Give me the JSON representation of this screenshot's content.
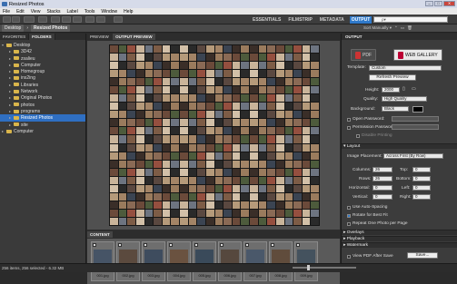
{
  "window": {
    "title": "Resized Photos"
  },
  "menu": [
    "File",
    "Edit",
    "View",
    "Stacks",
    "Label",
    "Tools",
    "Window",
    "Help"
  ],
  "workspaces": [
    {
      "label": "ESSENTIALS",
      "active": false
    },
    {
      "label": "FILMSTRIP",
      "active": false
    },
    {
      "label": "METADATA",
      "active": false
    },
    {
      "label": "OUTPUT",
      "active": true
    }
  ],
  "search": {
    "placeholder": "ρ▾"
  },
  "breadcrumb": {
    "root": "Desktop",
    "current": "Resized Photos"
  },
  "sort": {
    "label": "Sort Manually ▾"
  },
  "leftpanel": {
    "tabs": [
      "FAVORITES",
      "FOLDERS"
    ],
    "tree": [
      {
        "label": "Desktop",
        "level": 0,
        "open": true
      },
      {
        "label": "3D42",
        "level": 1
      },
      {
        "label": "zsalieu",
        "level": 1
      },
      {
        "label": "Computer",
        "level": 1
      },
      {
        "label": "Homegroup",
        "level": 1
      },
      {
        "label": "ins2ing",
        "level": 1
      },
      {
        "label": "Libraries",
        "level": 1
      },
      {
        "label": "Network",
        "level": 1
      },
      {
        "label": "Original Photos",
        "level": 1
      },
      {
        "label": "photos",
        "level": 1
      },
      {
        "label": "programs",
        "level": 1
      },
      {
        "label": "Resized Photos",
        "level": 1,
        "selected": true
      },
      {
        "label": "site",
        "level": 1
      },
      {
        "label": "Computer",
        "level": 0
      }
    ]
  },
  "center": {
    "tabs": [
      "PREVIEW",
      "OUTPUT PREVIEW"
    ],
    "content_tab": "CONTENT",
    "thumbs": [
      "001.jpg",
      "002.jpg",
      "003.jpg",
      "004.jpg",
      "005.jpg",
      "006.jpg",
      "007.jpg",
      "008.jpg",
      "009.jpg"
    ]
  },
  "output": {
    "header": "OUTPUT",
    "pdf_label": "PDF",
    "web_label": "WEB GALLERY",
    "template_label": "Template:",
    "template_value": "Custom",
    "refresh_label": "Refresh Preview",
    "height_label": "Height:",
    "height_value": "2000",
    "quality_label": "Quality:",
    "quality_value": "High Quality",
    "background_label": "Background:",
    "background_value": "Black",
    "open_password": "Open Password:",
    "perm_password": "Permission Password:",
    "disable_printing": "Disable Printing",
    "layout_section": "Layout",
    "placement_label": "Image Placement:",
    "placement_value": "Across First (By Row)",
    "columns_label": "Columns:",
    "columns_value": "26",
    "rows_label": "Rows:",
    "rows_value": "26",
    "horizontal_label": "Horizontal:",
    "horizontal_value": "0",
    "vertical_label": "Vertical:",
    "vertical_value": "0",
    "top_label": "Top:",
    "top_value": "0",
    "bottom_label": "Bottom:",
    "bottom_value": "0",
    "left_label": "Left:",
    "left_value": "0",
    "right_label": "Right:",
    "right_value": "0",
    "auto_spacing": "Use Auto-Spacing",
    "rotate_fit": "Rotate for Best Fit",
    "repeat_one": "Repeat One Photo per Page",
    "overlays": "Overlays",
    "playback": "Playback",
    "watermark": "Watermark",
    "view_pdf": "View PDF After Save",
    "save": "Save..."
  },
  "status": {
    "text": "256 items, 256 selected - 6.32 MB"
  }
}
